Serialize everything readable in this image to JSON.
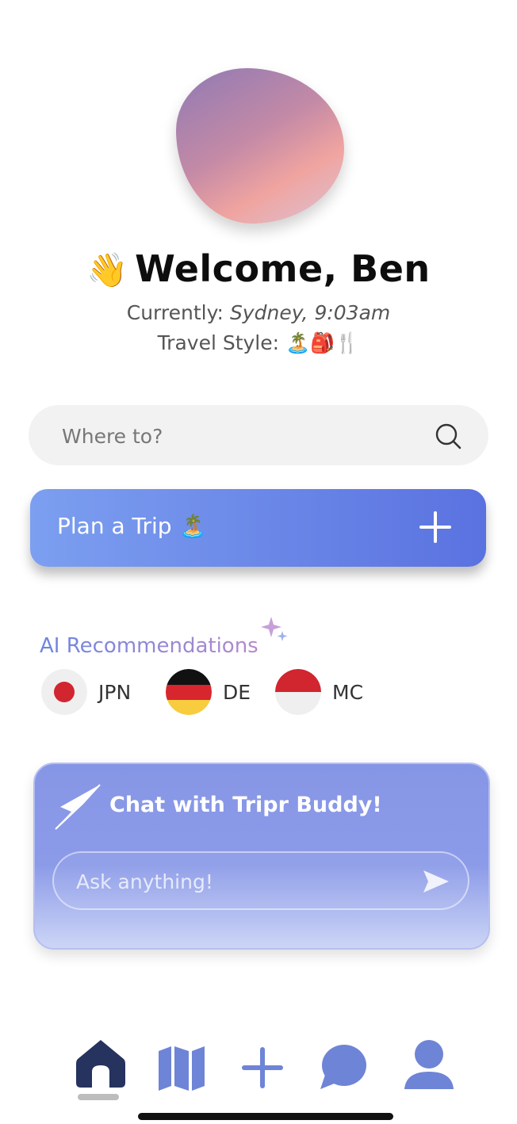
{
  "header": {
    "wave_emoji": "👋",
    "welcome": "Welcome, Ben",
    "currently_label": "Currently:",
    "currently_value": "Sydney, 9:03am",
    "travel_style_label": "Travel Style:",
    "travel_style_emojis": "🏝️🎒🍴"
  },
  "search": {
    "placeholder": "Where to?"
  },
  "plan_trip": {
    "label": "Plan a Trip 🏝️"
  },
  "ai_recommendations": {
    "title": "AI Recommendations",
    "items": [
      {
        "code": "JPN"
      },
      {
        "code": "DE"
      },
      {
        "code": "MC"
      }
    ]
  },
  "chat": {
    "title": "Chat with Tripr Buddy!",
    "placeholder": "Ask anything!"
  },
  "colors": {
    "accent": "#5a72e0",
    "nav_active": "#26335f",
    "nav_inactive": "#6e84d6"
  },
  "nav": {
    "items": [
      "home-icon",
      "map-icon",
      "add-icon",
      "chat-icon",
      "profile-icon"
    ]
  }
}
